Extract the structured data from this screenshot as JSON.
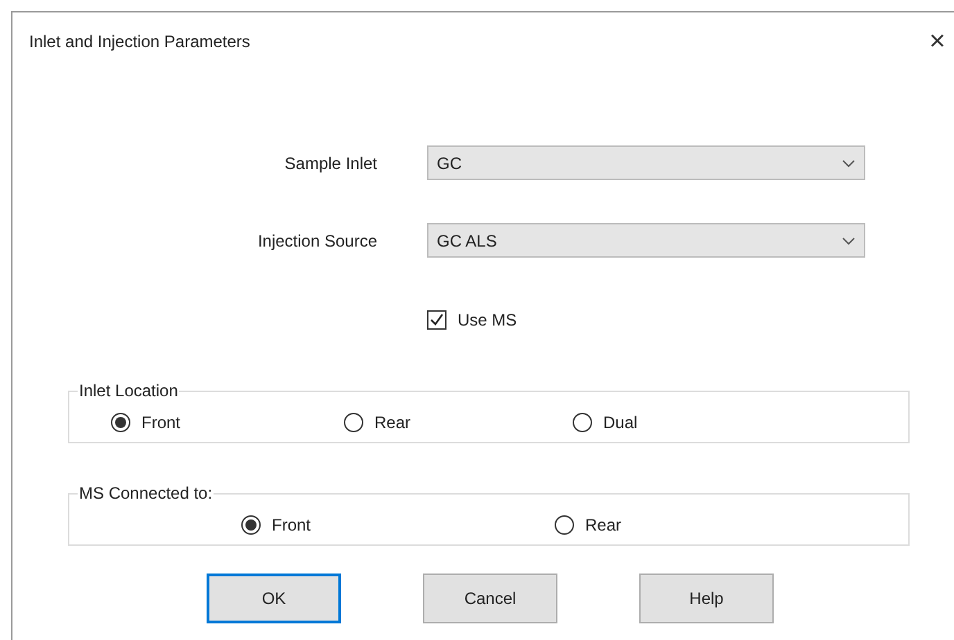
{
  "window": {
    "title": "Inlet and Injection Parameters",
    "close": "×"
  },
  "fields": [
    {
      "label": "Sample Inlet",
      "value": "GC"
    },
    {
      "label": "Injection Source",
      "value": "GC ALS"
    }
  ],
  "use_ms": {
    "label": "Use MS",
    "checked": true
  },
  "groups": [
    {
      "title": "Inlet Location",
      "options": [
        {
          "label": "Front",
          "selected": true
        },
        {
          "label": "Rear",
          "selected": false
        },
        {
          "label": "Dual",
          "selected": false
        }
      ]
    },
    {
      "title": "MS Connected to:",
      "options": [
        {
          "label": "Front",
          "selected": true
        },
        {
          "label": "Rear",
          "selected": false
        }
      ]
    }
  ],
  "buttons": [
    {
      "label": "OK",
      "default": true
    },
    {
      "label": "Cancel",
      "default": false
    },
    {
      "label": "Help",
      "default": false
    }
  ]
}
